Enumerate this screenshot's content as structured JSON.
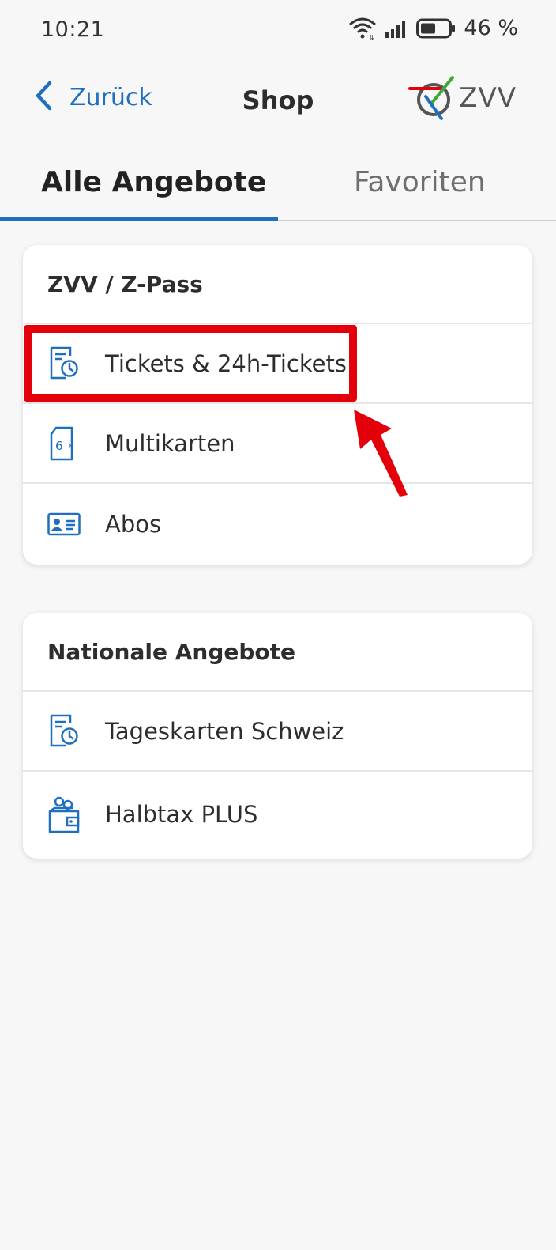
{
  "status_bar": {
    "time": "10:21",
    "battery_percent": "46 %"
  },
  "header": {
    "back_label": "Zurück",
    "title": "Shop",
    "logo_text": "ZVV"
  },
  "tabs": [
    {
      "label": "Alle Angebote",
      "active": true
    },
    {
      "label": "Favoriten",
      "active": false
    }
  ],
  "sections": [
    {
      "title": "ZVV / Z-Pass",
      "items": [
        {
          "label": "Tickets & 24h-Tickets",
          "icon": "ticket-clock-icon"
        },
        {
          "label": "Multikarten",
          "icon": "multicard-6x-icon"
        },
        {
          "label": "Abos",
          "icon": "id-card-icon"
        }
      ]
    },
    {
      "title": "Nationale Angebote",
      "items": [
        {
          "label": "Tageskarten Schweiz",
          "icon": "ticket-clock-icon"
        },
        {
          "label": "Halbtax PLUS",
          "icon": "wallet-coins-icon"
        }
      ]
    }
  ],
  "colors": {
    "accent": "#1f6fbf",
    "highlight": "#e3000b",
    "background": "#f7f7f7"
  }
}
